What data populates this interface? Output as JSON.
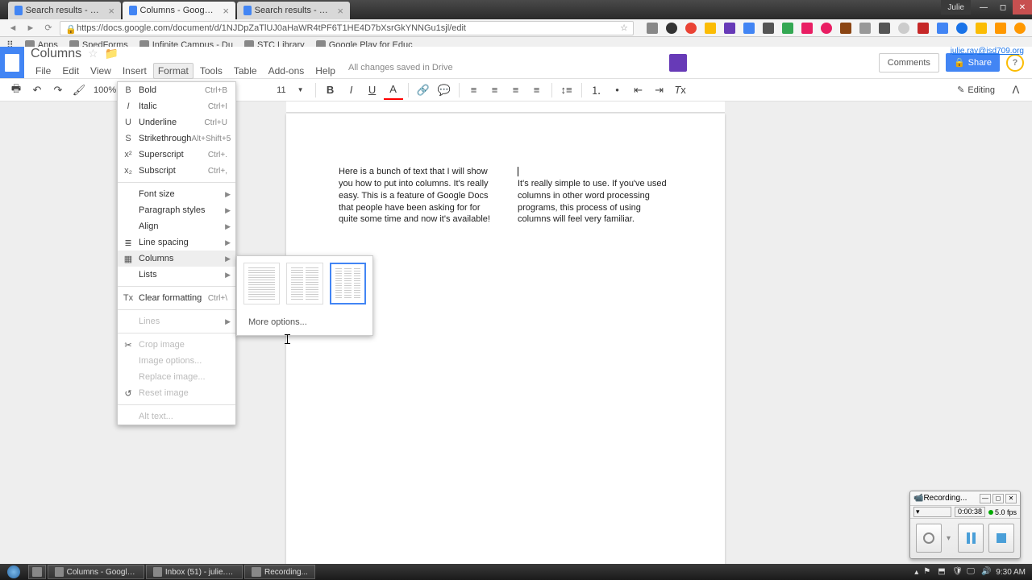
{
  "browser": {
    "user": "Julie",
    "tabs": [
      {
        "label": "Search results - Google",
        "active": false
      },
      {
        "label": "Columns - Google Docs",
        "active": true
      },
      {
        "label": "Search results - Google",
        "active": false
      }
    ],
    "url": "https://docs.google.com/document/d/1NJDpZaTlUJ0aHaWR4tPF6T1HE4D7bXsrGkYNNGu1sjl/edit",
    "bookmarks": [
      {
        "label": "Apps"
      },
      {
        "label": "SpedForms"
      },
      {
        "label": "Infinite Campus - Du"
      },
      {
        "label": "STC Library"
      },
      {
        "label": "Google Play for Educ"
      }
    ]
  },
  "docs": {
    "title": "Columns",
    "user_email": "julie.ray@isd709.org",
    "save_status": "All changes saved in Drive",
    "menus": [
      "File",
      "Edit",
      "View",
      "Insert",
      "Format",
      "Tools",
      "Table",
      "Add-ons",
      "Help"
    ],
    "active_menu_index": 4,
    "comments_label": "Comments",
    "share_label": "Share",
    "editing_label": "Editing",
    "zoom": "100%",
    "font_size": "11"
  },
  "format_menu": {
    "items": [
      {
        "icon": "B",
        "label": "Bold",
        "shortcut": "Ctrl+B"
      },
      {
        "icon": "I",
        "label": "Italic",
        "shortcut": "Ctrl+I",
        "italic": true
      },
      {
        "icon": "U",
        "label": "Underline",
        "shortcut": "Ctrl+U"
      },
      {
        "icon": "S",
        "label": "Strikethrough",
        "shortcut": "Alt+Shift+5"
      },
      {
        "icon": "x²",
        "label": "Superscript",
        "shortcut": "Ctrl+."
      },
      {
        "icon": "x₂",
        "label": "Subscript",
        "shortcut": "Ctrl+,"
      },
      {
        "sep": true
      },
      {
        "label": "Font size",
        "submenu": true
      },
      {
        "label": "Paragraph styles",
        "submenu": true
      },
      {
        "label": "Align",
        "submenu": true
      },
      {
        "icon": "≣",
        "label": "Line spacing",
        "submenu": true
      },
      {
        "icon": "▦",
        "label": "Columns",
        "submenu": true,
        "highlighted": true
      },
      {
        "label": "Lists",
        "submenu": true
      },
      {
        "sep": true
      },
      {
        "icon": "Tx",
        "label": "Clear formatting",
        "shortcut": "Ctrl+\\"
      },
      {
        "sep": true
      },
      {
        "label": "Lines",
        "submenu": true,
        "disabled": true
      },
      {
        "sep": true
      },
      {
        "icon": "✂",
        "label": "Crop image",
        "disabled": true
      },
      {
        "label": "Image options...",
        "disabled": true
      },
      {
        "label": "Replace image...",
        "disabled": true
      },
      {
        "icon": "↺",
        "label": "Reset image",
        "disabled": true
      },
      {
        "sep": true
      },
      {
        "label": "Alt text...",
        "disabled": true
      }
    ]
  },
  "columns_submenu": {
    "options": [
      {
        "cols": 1,
        "selected": false
      },
      {
        "cols": 2,
        "selected": false
      },
      {
        "cols": 3,
        "selected": true
      }
    ],
    "more_options": "More options..."
  },
  "document": {
    "col1": "Here is a bunch of text that I will show you how to put into columns. It's really easy. This is a feature of Google Docs that people have been asking for for quite some time and now it's available!",
    "col2": "It's really simple to use. If you've used columns in other word processing programs, this process of using columns will feel very familiar."
  },
  "recording": {
    "title": "Recording...",
    "time": "0:00:38",
    "fps": "5.0 fps"
  },
  "taskbar": {
    "items": [
      {
        "label": "Columns - Google D..."
      },
      {
        "label": "Inbox (51) - julie.ray..."
      },
      {
        "label": "Recording..."
      }
    ],
    "time": "9:30 AM"
  }
}
